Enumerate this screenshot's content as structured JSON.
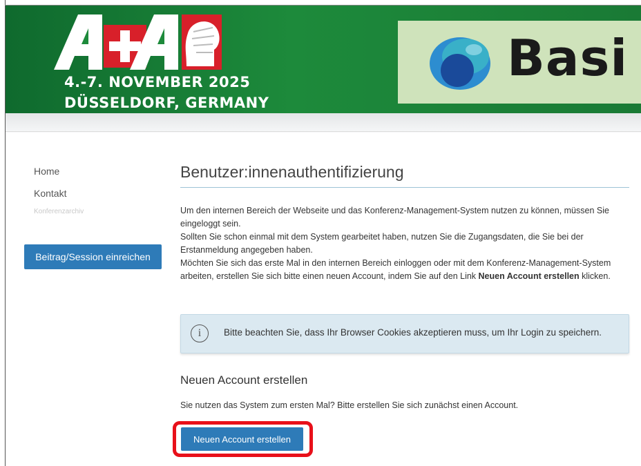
{
  "banner": {
    "logo_name": "A+A",
    "event_date": "4.-7. NOVEMBER 2025",
    "event_place": "DÜSSELDORF, GERMANY",
    "sponsor_name": "Basi",
    "colors": {
      "banner_green": "#1d8a3b",
      "sponsor_bg": "#cfe3bb",
      "cross_red": "#d8202a"
    }
  },
  "sidebar": {
    "items": [
      {
        "label": "Home"
      },
      {
        "label": "Kontakt"
      },
      {
        "label": "Konferenzarchiv"
      }
    ],
    "submit_button": "Beitrag/Session einreichen"
  },
  "main": {
    "title": "Benutzer:innenauthentifizierung",
    "intro_line1": "Um den internen Bereich der Webseite und das Konferenz-Management-System nutzen zu können, müssen Sie eingeloggt sein.",
    "intro_line2": "Sollten Sie schon einmal mit dem System gearbeitet haben, nutzen Sie die Zugangsdaten, die Sie bei der Erstanmeldung angegeben haben.",
    "intro_line3_before": "Möchten Sie sich das erste Mal in den internen Bereich einloggen oder mit dem Konferenz-Management-System arbeiten, erstellen Sie sich bitte einen neuen Account, indem Sie auf den Link ",
    "intro_line3_bold": "Neuen Account erstellen",
    "intro_line3_after": " klicken.",
    "notice_icon": "info-icon",
    "notice_text": "Bitte beachten Sie, dass Ihr Browser Cookies akzeptieren muss, um Ihr Login zu speichern.",
    "new_account": {
      "title": "Neuen Account erstellen",
      "description": "Sie nutzen das System zum ersten Mal? Bitte erstellen Sie sich zunächst einen Account.",
      "button": "Neuen Account erstellen"
    },
    "colors": {
      "accent": "#2e7bb8",
      "highlight": "#e8101a",
      "notice_bg": "#dbe9f1"
    }
  }
}
